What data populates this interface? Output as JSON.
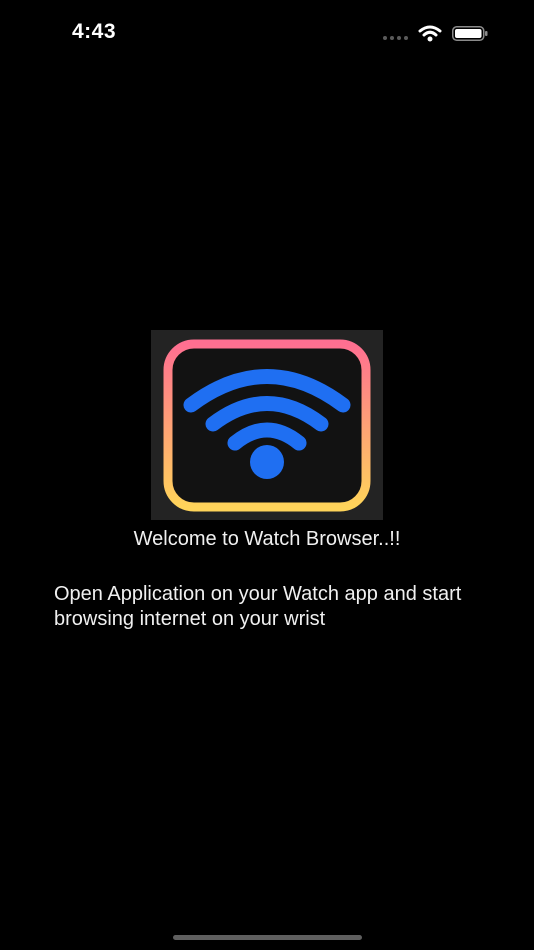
{
  "status_bar": {
    "time": "4:43",
    "icons": [
      "cellular-signal-icon",
      "wifi-icon",
      "battery-icon"
    ]
  },
  "app_icon": {
    "icon": "wifi-icon",
    "colors": {
      "background": "#232323",
      "frame_top": "#ff6f91",
      "frame_bottom": "#ffd45a",
      "frame_inner": "#121212",
      "signal": "#1f6ff2"
    }
  },
  "welcome": {
    "title": "Welcome to Watch Browser..!!"
  },
  "instructions": {
    "text": "Open Application on your Watch app and start browsing internet on your wrist"
  }
}
